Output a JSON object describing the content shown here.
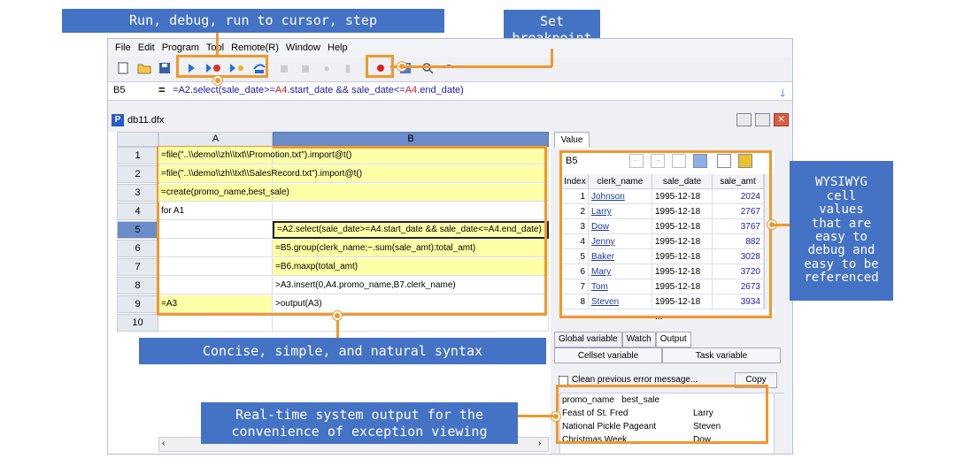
{
  "callouts": {
    "run_debug": "Run, debug, run to cursor, step",
    "set_breakpoint_line1": "Set",
    "set_breakpoint_line2": "breakpoint",
    "concise": "Concise, simple, and natural syntax",
    "realtime_line1": "Real-time system output for the",
    "realtime_line2": "convenience of exception viewing",
    "wysiwyg": [
      "WYSIWYG",
      "cell",
      "values",
      "that are",
      "easy to",
      "debug and",
      "easy to be",
      "referenced"
    ]
  },
  "menu": [
    "File",
    "Edit",
    "Program",
    "Tool",
    "Remote(R)",
    "Window",
    "Help"
  ],
  "formula": {
    "cell_ref": "B5",
    "equals": "=",
    "parts": [
      {
        "t": "=",
        "c": "#1a1aa8"
      },
      {
        "t": "A2",
        "c": "#1a1aa8"
      },
      {
        "t": ".select(sale_date>=",
        "c": "#1a1aa8"
      },
      {
        "t": "A4",
        "c": "#d02020"
      },
      {
        "t": ".start_date && sale_date<=",
        "c": "#1a1aa8"
      },
      {
        "t": "A4",
        "c": "#d02020"
      },
      {
        "t": ".end_date)",
        "c": "#1a1aa8"
      }
    ]
  },
  "doc_tab": "db11.dfx",
  "grid": {
    "col_a": "A",
    "col_b": "B",
    "rows": [
      {
        "n": "1",
        "a": "=file(\"..\\\\demo\\\\zh\\\\txt\\\\Promotion.txt\").import@t()",
        "b": "",
        "ay": true,
        "by": true
      },
      {
        "n": "2",
        "a": "=file(\"..\\\\demo\\\\zh\\\\txt\\\\SalesRecord.txt\").import@t()",
        "b": "",
        "ay": true,
        "by": true
      },
      {
        "n": "3",
        "a": "=create(promo_name,best_sale)",
        "b": "",
        "ay": true,
        "by": true
      },
      {
        "n": "4",
        "a": "for A1",
        "b": "",
        "ay": false,
        "by": false
      },
      {
        "n": "5",
        "a": "",
        "b": "=A2.select(sale_date>=A4.start_date && sale_date<=A4.end_date)",
        "ay": false,
        "by": true
      },
      {
        "n": "6",
        "a": "",
        "b": "=B5.group(clerk_name;~.sum(sale_amt):total_amt)",
        "ay": false,
        "by": true
      },
      {
        "n": "7",
        "a": "",
        "b": "=B6.maxp(total_amt)",
        "ay": false,
        "by": true
      },
      {
        "n": "8",
        "a": "",
        "b": ">A3.insert(0,A4.promo_name,B7.clerk_name)",
        "ay": false,
        "by": false
      },
      {
        "n": "9",
        "a": "=A3",
        "b": ">output(A3)",
        "ay": true,
        "by": false
      },
      {
        "n": "10",
        "a": "",
        "b": "",
        "ay": false,
        "by": false
      }
    ]
  },
  "value_panel": {
    "tab": "Value",
    "cell_ref": "B5",
    "headers": [
      "Index",
      "clerk_name",
      "sale_date",
      "sale_amt"
    ],
    "rows": [
      [
        "1",
        "Johnson",
        "1995-12-18 ...",
        "2024"
      ],
      [
        "2",
        "Larry",
        "1995-12-18 ...",
        "2767"
      ],
      [
        "3",
        "Dow",
        "1995-12-18 ...",
        "3767"
      ],
      [
        "4",
        "Jenny",
        "1995-12-18 ...",
        "882"
      ],
      [
        "5",
        "Baker",
        "1995-12-18 ...",
        "3028"
      ],
      [
        "6",
        "Mary",
        "1995-12-18 ...",
        "3720"
      ],
      [
        "7",
        "Tom",
        "1995-12-18 ...",
        "2673"
      ],
      [
        "8",
        "Steven",
        "1995-12-18 ...",
        "3934"
      ]
    ]
  },
  "bottom_tabs": [
    "Global variable",
    "Watch",
    "Output"
  ],
  "sub_tabs": [
    "Cellset variable",
    "Task variable"
  ],
  "clean_label": "Clean previous error message...",
  "copy_label": "Copy",
  "output": {
    "header": "promo_name   best_sale",
    "rows": [
      [
        "Feast of St. Fred",
        "Larry"
      ],
      [
        "National Pickle Pageant",
        "Steven"
      ],
      [
        "Christmas Week",
        "Dow"
      ]
    ]
  },
  "colors": {
    "accent": "#4472c4",
    "highlight": "#f0982c",
    "cell_yellow": "#ffffa8"
  },
  "icons": [
    "new-file-icon",
    "open-folder-icon",
    "save-icon",
    "run-icon",
    "debug-icon",
    "run-to-cursor-icon",
    "step-icon",
    "breakpoint-icon",
    "calculator-icon",
    "search-icon",
    "undo-icon",
    "down-arrow-icon",
    "minimize-icon",
    "restore-icon",
    "close-icon"
  ]
}
